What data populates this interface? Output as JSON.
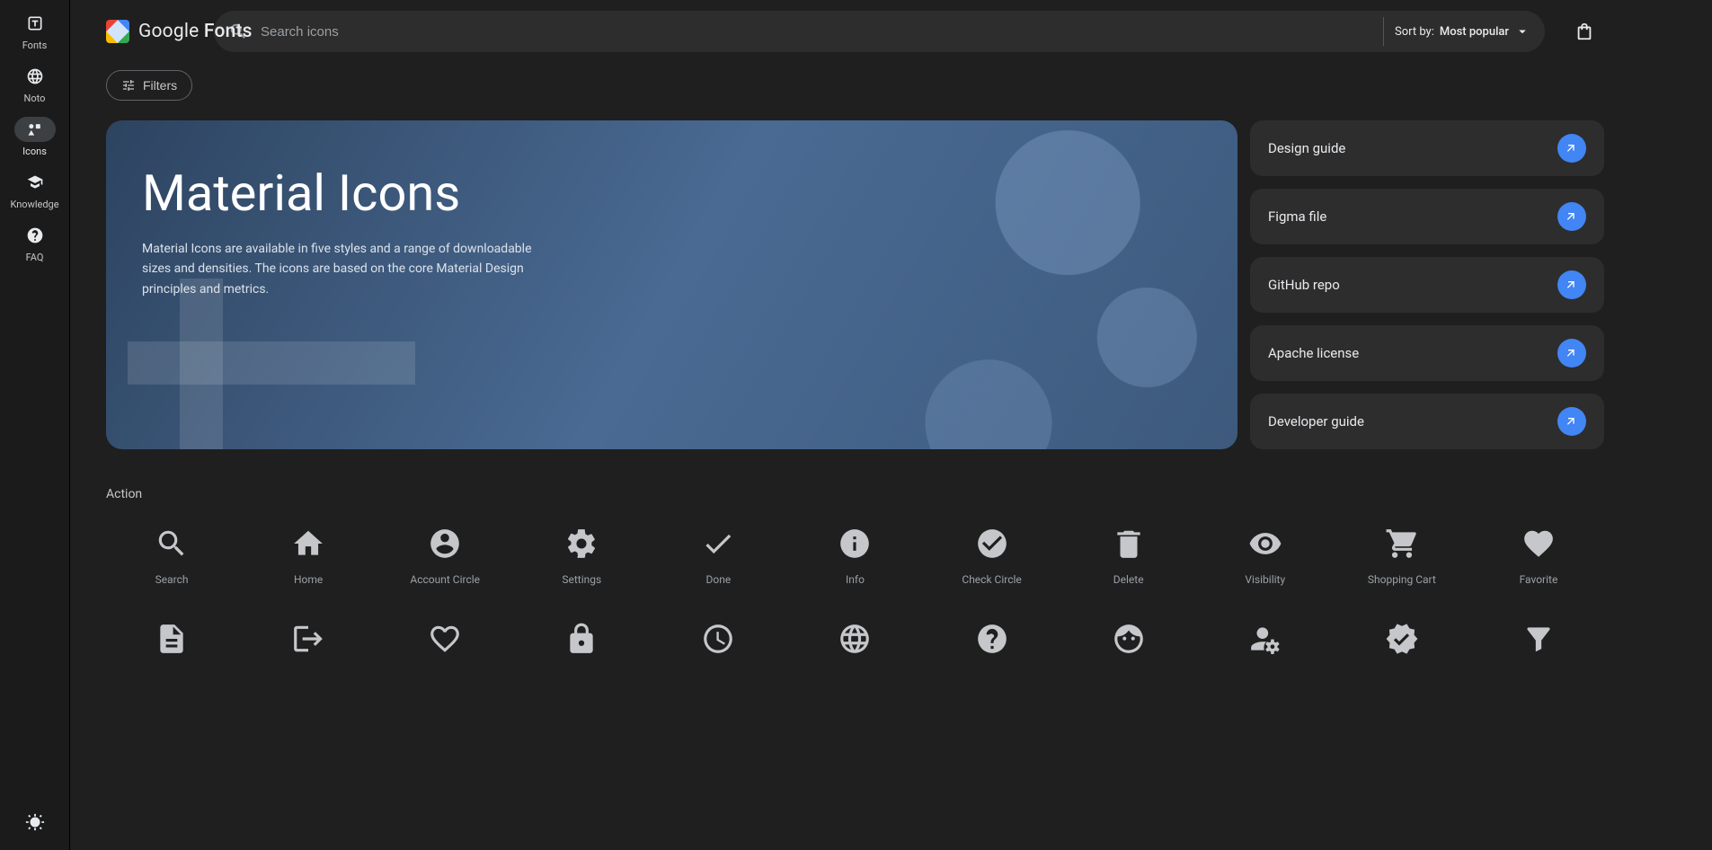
{
  "brand": {
    "name": "Google",
    "product": "Fonts"
  },
  "sidebar": {
    "items": [
      {
        "label": "Fonts"
      },
      {
        "label": "Noto"
      },
      {
        "label": "Icons"
      },
      {
        "label": "Knowledge"
      },
      {
        "label": "FAQ"
      }
    ],
    "active_index": 2
  },
  "search": {
    "placeholder": "Search icons"
  },
  "sort": {
    "prefix": "Sort by:",
    "value": "Most popular"
  },
  "filters": {
    "chip_label": "Filters"
  },
  "hero": {
    "title": "Material Icons",
    "description": "Material Icons are available in five styles and a range of downloadable sizes and densities. The icons are based on the core Material Design principles and metrics."
  },
  "hero_links": [
    {
      "label": "Design guide"
    },
    {
      "label": "Figma file"
    },
    {
      "label": "GitHub repo"
    },
    {
      "label": "Apache license"
    },
    {
      "label": "Developer guide"
    }
  ],
  "section": {
    "title": "Action"
  },
  "icons": {
    "row1": [
      {
        "label": "Search",
        "glyph": "search"
      },
      {
        "label": "Home",
        "glyph": "home"
      },
      {
        "label": "Account Circle",
        "glyph": "account_circle"
      },
      {
        "label": "Settings",
        "glyph": "settings"
      },
      {
        "label": "Done",
        "glyph": "done"
      },
      {
        "label": "Info",
        "glyph": "info"
      },
      {
        "label": "Check Circle",
        "glyph": "check_circle"
      },
      {
        "label": "Delete",
        "glyph": "delete"
      },
      {
        "label": "Visibility",
        "glyph": "visibility"
      },
      {
        "label": "Shopping Cart",
        "glyph": "shopping_cart"
      },
      {
        "label": "Favorite",
        "glyph": "favorite"
      }
    ],
    "row2": [
      {
        "label": "",
        "glyph": "description"
      },
      {
        "label": "",
        "glyph": "logout"
      },
      {
        "label": "",
        "glyph": "favorite_border"
      },
      {
        "label": "",
        "glyph": "lock"
      },
      {
        "label": "",
        "glyph": "schedule"
      },
      {
        "label": "",
        "glyph": "language"
      },
      {
        "label": "",
        "glyph": "help"
      },
      {
        "label": "",
        "glyph": "face"
      },
      {
        "label": "",
        "glyph": "manage_accounts"
      },
      {
        "label": "",
        "glyph": "verified"
      },
      {
        "label": "",
        "glyph": "filter_alt"
      }
    ]
  }
}
